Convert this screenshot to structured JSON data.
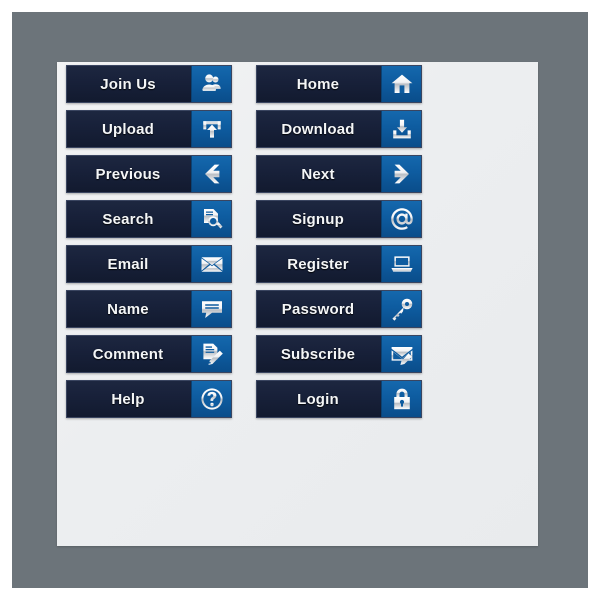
{
  "frame": {
    "outer_color": "#6c747a",
    "panel_color": "#eceef0",
    "background_color": "#ffffff"
  },
  "theme": {
    "button_dark": "#18213a",
    "button_border": "#3a4560",
    "icon_blue": "#0e5ca0",
    "label_color": "#f4f6f8",
    "icon_silver": "#e8eaec"
  },
  "buttons": [
    {
      "label": "Join Us",
      "icon": "users-icon",
      "column": "left",
      "row": 1
    },
    {
      "label": "Home",
      "icon": "house-icon",
      "column": "right",
      "row": 1
    },
    {
      "label": "Upload",
      "icon": "upload-arrow-icon",
      "column": "left",
      "row": 2
    },
    {
      "label": "Download",
      "icon": "download-tray-icon",
      "column": "right",
      "row": 2
    },
    {
      "label": "Previous",
      "icon": "arrow-left-icon",
      "column": "left",
      "row": 3
    },
    {
      "label": "Next",
      "icon": "arrow-right-icon",
      "column": "right",
      "row": 3
    },
    {
      "label": "Search",
      "icon": "magnifier-page-icon",
      "column": "left",
      "row": 4
    },
    {
      "label": "Signup",
      "icon": "at-sign-icon",
      "column": "right",
      "row": 4
    },
    {
      "label": "Email",
      "icon": "envelope-icon",
      "column": "left",
      "row": 5
    },
    {
      "label": "Register",
      "icon": "laptop-icon",
      "column": "right",
      "row": 5
    },
    {
      "label": "Name",
      "icon": "speech-bubble-icon",
      "column": "left",
      "row": 6
    },
    {
      "label": "Password",
      "icon": "key-icon",
      "column": "right",
      "row": 6
    },
    {
      "label": "Comment",
      "icon": "page-pen-icon",
      "column": "left",
      "row": 7
    },
    {
      "label": "Subscribe",
      "icon": "envelope-pen-icon",
      "column": "right",
      "row": 7
    },
    {
      "label": "Help",
      "icon": "question-circle-icon",
      "column": "left",
      "row": 8
    },
    {
      "label": "Login",
      "icon": "padlock-icon",
      "column": "right",
      "row": 8
    }
  ]
}
